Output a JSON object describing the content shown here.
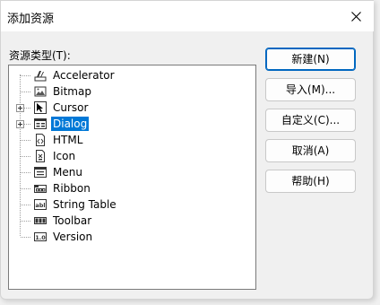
{
  "window": {
    "title": "添加资源"
  },
  "tree": {
    "label": "资源类型(T):",
    "items": [
      {
        "label": "Accelerator",
        "icon": "accelerator-icon",
        "expandable": false,
        "selected": false
      },
      {
        "label": "Bitmap",
        "icon": "bitmap-icon",
        "expandable": false,
        "selected": false
      },
      {
        "label": "Cursor",
        "icon": "cursor-icon",
        "expandable": true,
        "selected": false
      },
      {
        "label": "Dialog",
        "icon": "dialog-icon",
        "expandable": true,
        "selected": true
      },
      {
        "label": "HTML",
        "icon": "html-icon",
        "expandable": false,
        "selected": false
      },
      {
        "label": "Icon",
        "icon": "icon-resource-icon",
        "expandable": false,
        "selected": false
      },
      {
        "label": "Menu",
        "icon": "menu-icon",
        "expandable": false,
        "selected": false
      },
      {
        "label": "Ribbon",
        "icon": "ribbon-icon",
        "expandable": false,
        "selected": false
      },
      {
        "label": "String Table",
        "icon": "string-table-icon",
        "expandable": false,
        "selected": false
      },
      {
        "label": "Toolbar",
        "icon": "toolbar-icon",
        "expandable": false,
        "selected": false
      },
      {
        "label": "Version",
        "icon": "version-icon",
        "expandable": false,
        "selected": false
      }
    ]
  },
  "buttons": {
    "new": "新建(N)",
    "import": "导入(M)...",
    "custom": "自定义(C)...",
    "cancel": "取消(A)",
    "help": "帮助(H)"
  },
  "colors": {
    "selection": "#0078d7",
    "default_button_border": "#0067c0"
  }
}
